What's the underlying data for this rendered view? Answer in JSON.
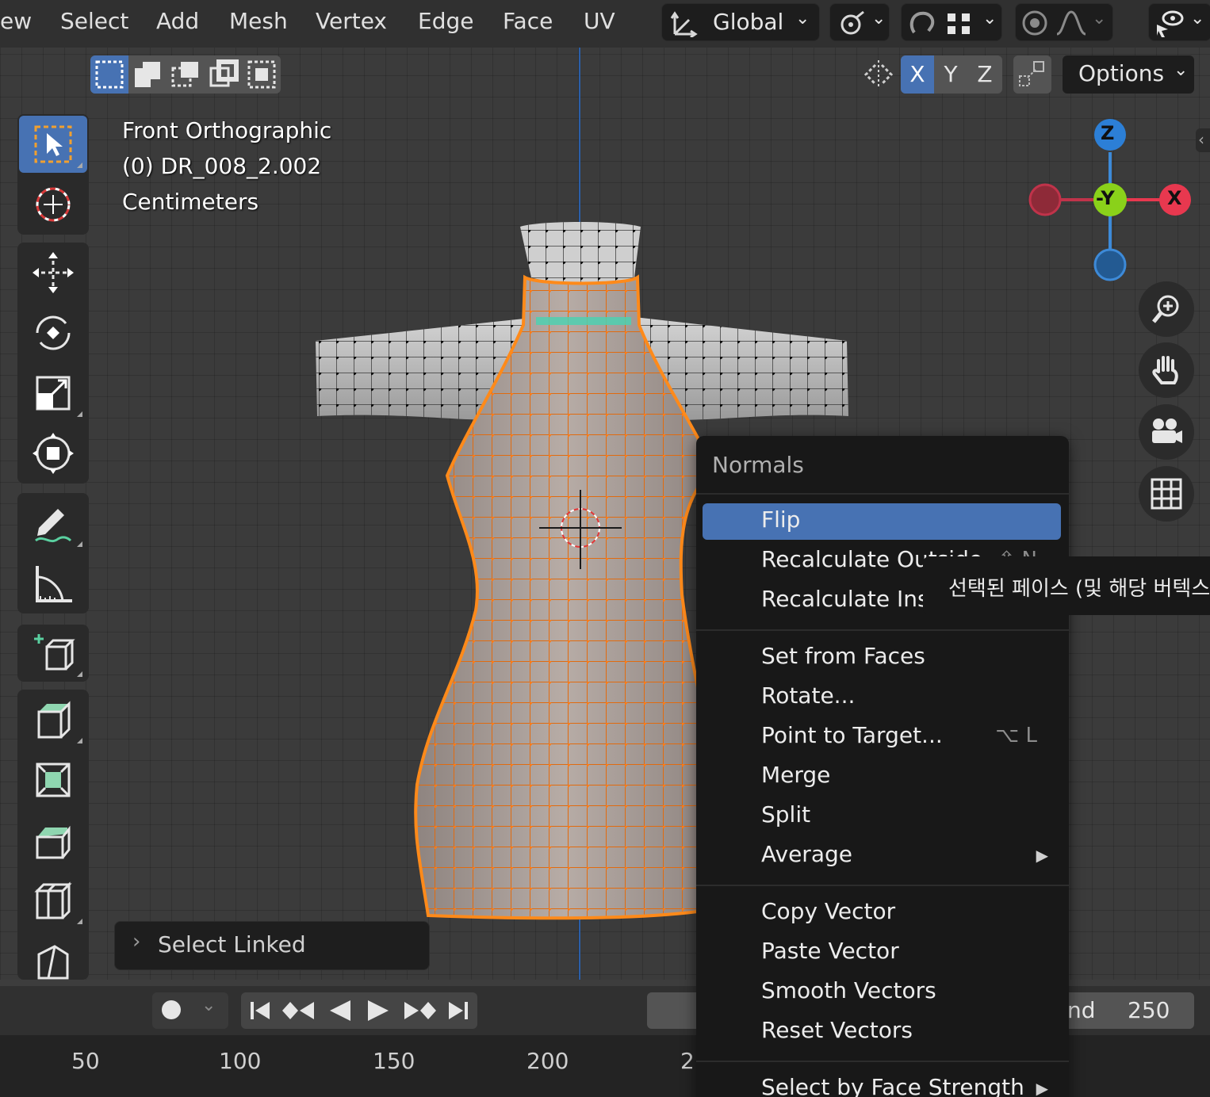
{
  "menubar": {
    "items": [
      "ew",
      "Select",
      "Add",
      "Mesh",
      "Vertex",
      "Edge",
      "Face",
      "UV"
    ],
    "transform_orientation": "Global"
  },
  "axis_buttons": [
    "X",
    "Y",
    "Z"
  ],
  "options_label": "Options",
  "viewport_info": {
    "view_name": "Front Orthographic",
    "object_name": "(0) DR_008_2.002",
    "units": "Centimeters"
  },
  "gizmo": {
    "z": "Z",
    "neg_y": "-Y",
    "x": "X"
  },
  "context_menu": {
    "title": "Normals",
    "items": [
      {
        "label": "Flip",
        "shortcut": "",
        "submenu": false
      },
      {
        "label": "Recalculate Outside",
        "shortcut": "⇧ N",
        "submenu": false
      },
      {
        "label": "Recalculate Inside",
        "shortcut": "",
        "submenu": false
      },
      {
        "label": "Set from Faces",
        "shortcut": "",
        "submenu": false
      },
      {
        "label": "Rotate...",
        "shortcut": "",
        "submenu": false
      },
      {
        "label": "Point to Target...",
        "shortcut": "⌥ L",
        "submenu": false
      },
      {
        "label": "Merge",
        "shortcut": "",
        "submenu": false
      },
      {
        "label": "Split",
        "shortcut": "",
        "submenu": false
      },
      {
        "label": "Average",
        "shortcut": "",
        "submenu": true
      },
      {
        "label": "Copy Vector",
        "shortcut": "",
        "submenu": false
      },
      {
        "label": "Paste Vector",
        "shortcut": "",
        "submenu": false
      },
      {
        "label": "Smooth Vectors",
        "shortcut": "",
        "submenu": false
      },
      {
        "label": "Reset Vectors",
        "shortcut": "",
        "submenu": false
      },
      {
        "label": "Select by Face Strength",
        "shortcut": "",
        "submenu": true
      }
    ]
  },
  "tooltip": {
    "text": "선택된 페이스 (및 해당 버텍스"
  },
  "last_operator": {
    "label": "Select Linked"
  },
  "timeline": {
    "end_label": "nd",
    "end_value": "250",
    "frame_markers": [
      "50",
      "100",
      "150",
      "200",
      "2"
    ]
  },
  "colors": {
    "accent": "#4772b3",
    "selected_mesh": "#ff8a1a",
    "axis_x": "#e8384f",
    "axis_y": "#8ad11a",
    "axis_z": "#2c7fd6"
  }
}
